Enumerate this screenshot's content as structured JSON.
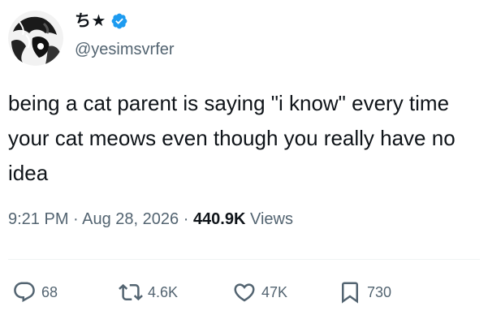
{
  "author": {
    "display_name": "ち★",
    "handle": "@yesimsvrfer",
    "verified": true,
    "verified_color": "#1d9bf0"
  },
  "tweet": {
    "text": "being a cat parent is saying \"i know\" every time your cat meows even though you really have no idea",
    "time": "9:21 PM",
    "separator1": " · ",
    "date": "Aug 28, 2026",
    "separator2": " · ",
    "views_count": "440.9K",
    "views_label": " Views"
  },
  "actions": {
    "replies": "68",
    "retweets": "4.6K",
    "likes": "47K",
    "bookmarks": "730"
  },
  "icons": {
    "reply": "speech-bubble-icon",
    "retweet": "retweet-arrows-icon",
    "like": "heart-outline-icon",
    "bookmark": "bookmark-outline-icon",
    "verified": "verified-badge-icon"
  },
  "colors": {
    "text_primary": "#0f1419",
    "text_secondary": "#536471",
    "divider": "#eff3f4"
  }
}
